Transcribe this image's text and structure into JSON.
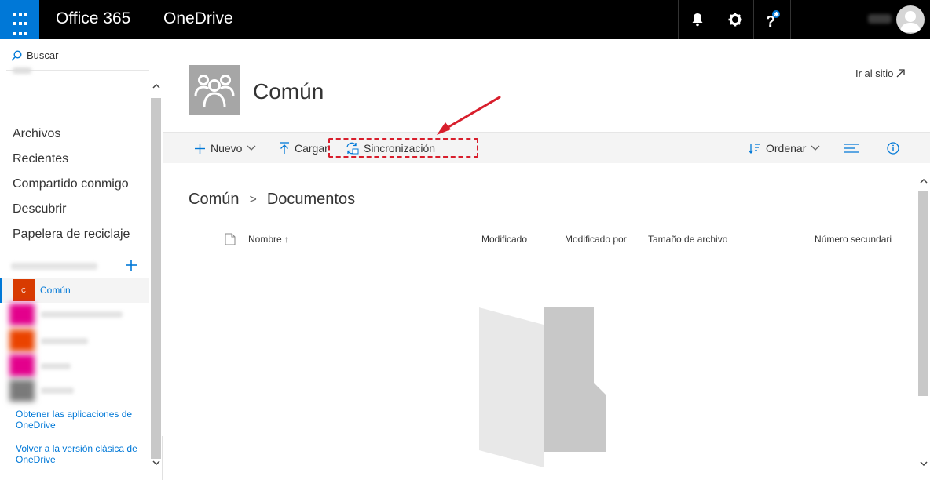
{
  "topbar": {
    "app_name": "Office 365",
    "product_name": "OneDrive",
    "accent_color": "#0078d7",
    "icons": [
      "waffle-icon",
      "bell-icon",
      "gear-icon",
      "help-icon",
      "avatar"
    ]
  },
  "leftnav": {
    "search_label": "Buscar",
    "items": [
      {
        "label": "Archivos"
      },
      {
        "label": "Recientes"
      },
      {
        "label": "Compartido conmigo"
      },
      {
        "label": "Descubrir"
      },
      {
        "label": "Papelera de reciclaje"
      }
    ],
    "active_site": {
      "badge": "C",
      "label": "Común",
      "badge_color": "#d83b01"
    },
    "blurred_site_colors": [
      "#e3008c",
      "#ea4300",
      "#e3008c",
      "#7a7a7a"
    ],
    "links": [
      "Obtener las aplicaciones de OneDrive",
      "Volver a la versión clásica de OneDrive"
    ]
  },
  "header": {
    "site_title": "Común",
    "go_to_site": "Ir al sitio"
  },
  "commandbar": {
    "new_label": "Nuevo",
    "upload_label": "Cargar",
    "sync_label": "Sincronización",
    "sort_label": "Ordenar",
    "highlight_color": "#d81e2c"
  },
  "breadcrumb": {
    "items": [
      "Común",
      "Documentos"
    ],
    "separator": ">"
  },
  "table": {
    "columns": [
      "Nombre",
      "Modificado",
      "Modificado por",
      "Tamaño de archivo",
      "Número secundari"
    ],
    "sort_indicator": "↑"
  }
}
